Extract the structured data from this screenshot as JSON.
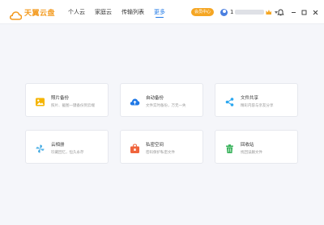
{
  "app": {
    "logo_text": "天翼云盘",
    "brand_color": "#f39a1e",
    "accent_color": "#1f78e6"
  },
  "nav": {
    "items": [
      {
        "label": "个人云",
        "active": false
      },
      {
        "label": "家庭云",
        "active": false
      },
      {
        "label": "传输列表",
        "active": false
      },
      {
        "label": "更多",
        "active": true
      }
    ]
  },
  "header": {
    "vip_label": "会员中心",
    "username": "1"
  },
  "window_controls": {
    "icons": [
      "bell-icon",
      "minimize-icon",
      "maximize-icon",
      "close-icon"
    ]
  },
  "features": [
    {
      "title": "照片备份",
      "desc": "照片、截图一键备份到云端",
      "icon": "photo-icon",
      "color": "#f5b400"
    },
    {
      "title": "自动备份",
      "desc": "文件实时备份，万无一失",
      "icon": "cloud-upload-icon",
      "color": "#1f78e6"
    },
    {
      "title": "文件共享",
      "desc": "精彩内容与亲友分享",
      "icon": "share-icon",
      "color": "#2aa7f0"
    },
    {
      "title": "云相册",
      "desc": "珍藏回忆，恒久永存",
      "icon": "pinwheel-icon",
      "color": "#3aa6e0"
    },
    {
      "title": "私密空间",
      "desc": "密码保护私密文件",
      "icon": "lock-box-icon",
      "color": "#f0643c"
    },
    {
      "title": "回收站",
      "desc": "找回误删文件",
      "icon": "trash-icon",
      "color": "#35b158"
    }
  ]
}
